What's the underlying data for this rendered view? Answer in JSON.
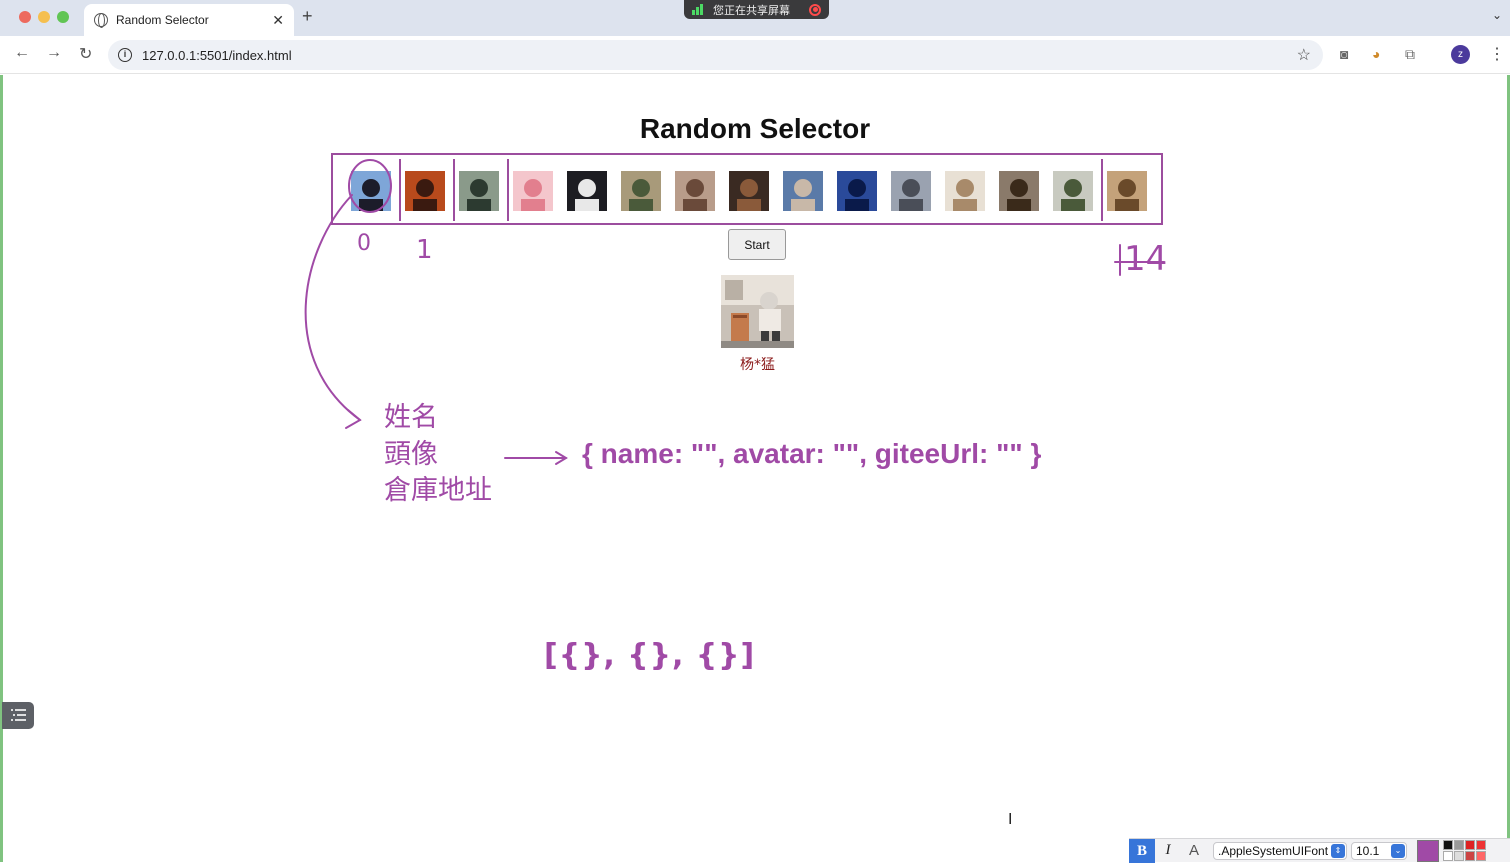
{
  "browser": {
    "tab_title": "Random Selector",
    "new_tab_label": "+",
    "tab_close_label": "✕",
    "url": "127.0.0.1:5501/index.html",
    "profile_initial": "z",
    "share_banner": "您正在共享屏幕"
  },
  "page": {
    "title": "Random Selector",
    "start_button": "Start",
    "selected": {
      "name": "杨*猛"
    },
    "avatar_count": 15
  },
  "annotations": {
    "fields": [
      "姓名",
      "頭像",
      "倉庫地址"
    ],
    "object_literal": "{ name: \"\", avatar: \"\", giteeUrl: \"\" }",
    "array_literal": "[{}, {}, {}]",
    "index_start": "0",
    "index_second": "1",
    "index_end": "14",
    "color": "#a04aa6"
  },
  "format_bar": {
    "bold": "B",
    "italic": "I",
    "text_effect": "A",
    "font_name": ".AppleSystemUIFont",
    "font_size": "10.1"
  }
}
